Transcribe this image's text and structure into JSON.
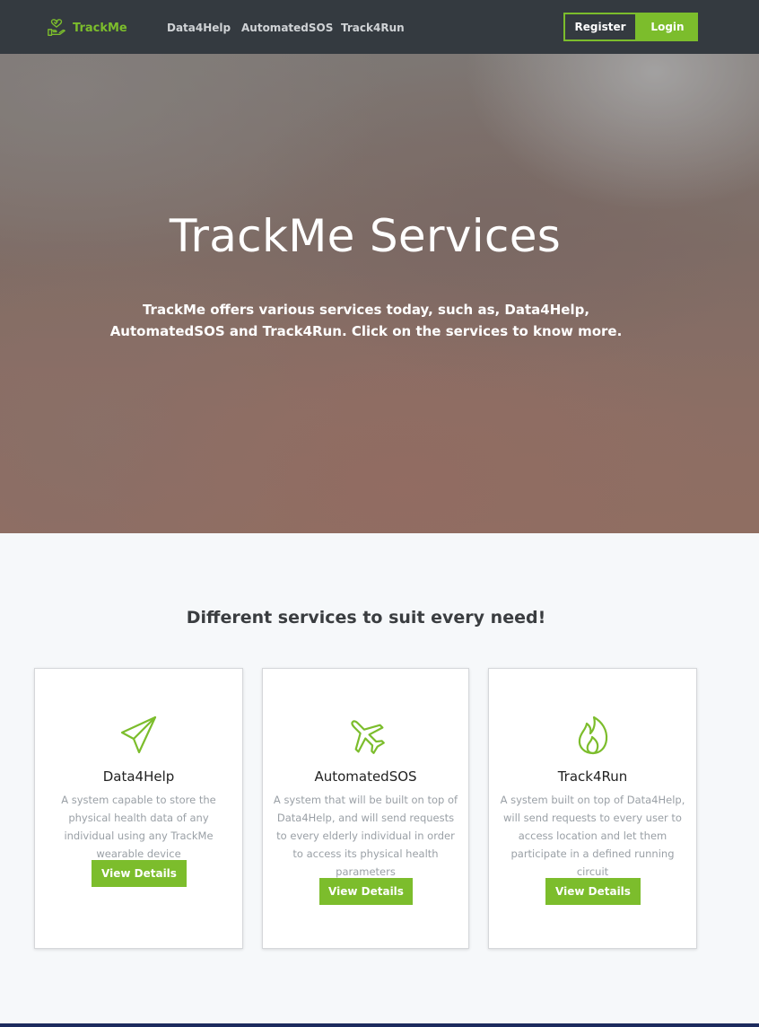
{
  "navbar": {
    "brand": "TrackMe",
    "links": [
      "Data4Help",
      "AutomatedSOS",
      "Track4Run"
    ],
    "register_label": "Register",
    "login_label": "Login"
  },
  "hero": {
    "title": "TrackMe Services",
    "subtitle": "TrackMe offers various services today, such as, Data4Help, AutomatedSOS and Track4Run. Click on the services to know more."
  },
  "services": {
    "heading": "Different services to suit every need!",
    "cards": [
      {
        "icon": "paper-plane-icon",
        "title": "Data4Help",
        "description": "A system capable to store the physical health data of any individual using any TrackMe wearable device",
        "button": "View Details"
      },
      {
        "icon": "airplane-icon",
        "title": "AutomatedSOS",
        "description": "A system that will be built on top of Data4Help, and will send requests to every elderly individual in order to access its physical health parameters",
        "button": "View Details"
      },
      {
        "icon": "fire-icon",
        "title": "Track4Run",
        "description": "A system built on top of Data4Help, will send requests to every user to access location and let them participate in a defined running circuit",
        "button": "View Details"
      }
    ]
  },
  "colors": {
    "accent": "#7cbd2c",
    "navbar_bg": "#343a40",
    "page_bg": "#f6f8fa"
  }
}
